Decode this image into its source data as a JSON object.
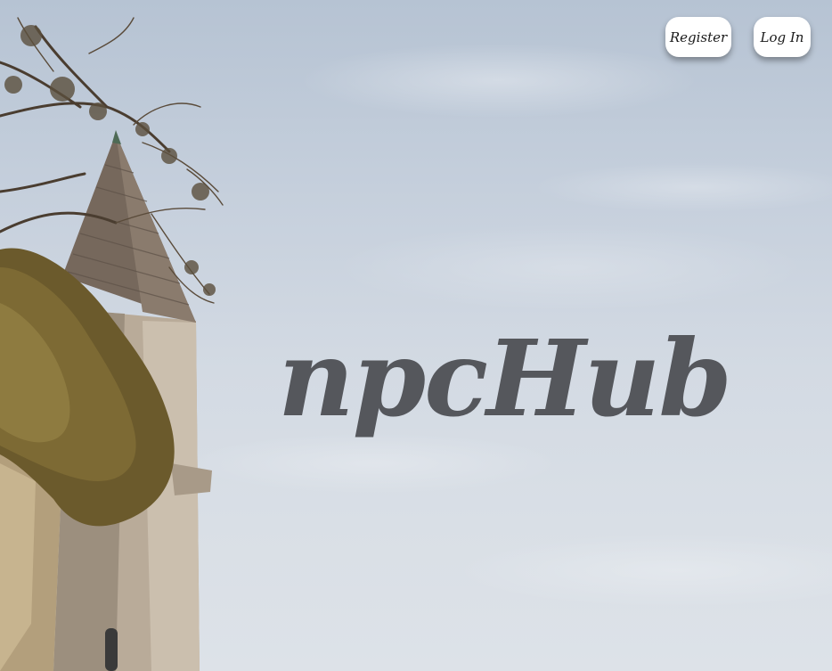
{
  "header": {
    "register_label": "Register",
    "login_label": "Log In"
  },
  "hero": {
    "title": "npcHub",
    "image_icon": "castle-tower-icon"
  },
  "colors": {
    "title": "#55575c",
    "sky": "#c5cfdc",
    "button_bg": "#ffffff"
  }
}
